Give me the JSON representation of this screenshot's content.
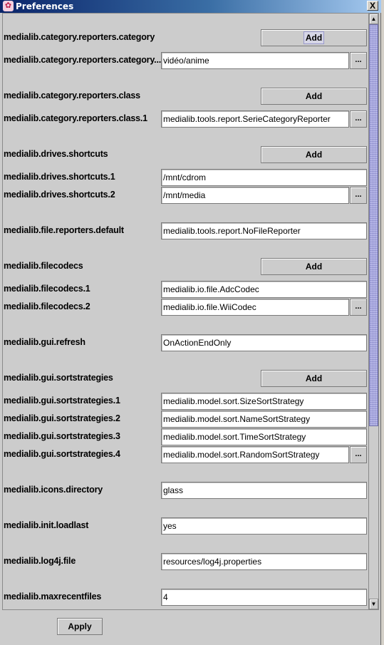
{
  "window": {
    "title": "Preferences",
    "icon": "app-icon",
    "close_label": "X"
  },
  "colors": {
    "title_gradient_start": "#0a246a",
    "title_gradient_end": "#a6caf0",
    "panel_bg": "#cccccc",
    "scroll_thumb": "#b8b8e8"
  },
  "scrollbar": {
    "up_label": "▲",
    "down_label": "▼",
    "visible_fraction": 0.7,
    "scroll_position": 0
  },
  "preferences": [
    {
      "type": "group",
      "label": "medialib.category.reporters.category",
      "button": "Add",
      "focused": true
    },
    {
      "type": "entry",
      "label": "medialib.category.reporters.category...",
      "value": "vidéo/anime",
      "browse": "..."
    },
    {
      "type": "group",
      "label": "medialib.category.reporters.class",
      "button": "Add"
    },
    {
      "type": "entry",
      "label": "medialib.category.reporters.class.1",
      "value": "medialib.tools.report.SerieCategoryReporter",
      "browse": "..."
    },
    {
      "type": "group",
      "label": "medialib.drives.shortcuts",
      "button": "Add"
    },
    {
      "type": "entry",
      "label": "medialib.drives.shortcuts.1",
      "value": "/mnt/cdrom"
    },
    {
      "type": "entry",
      "label": "medialib.drives.shortcuts.2",
      "value": "/mnt/media",
      "browse": "..."
    },
    {
      "type": "single",
      "label": "medialib.file.reporters.default",
      "value": "medialib.tools.report.NoFileReporter"
    },
    {
      "type": "group",
      "label": "medialib.filecodecs",
      "button": "Add"
    },
    {
      "type": "entry",
      "label": "medialib.filecodecs.1",
      "value": "medialib.io.file.AdcCodec"
    },
    {
      "type": "entry",
      "label": "medialib.filecodecs.2",
      "value": "medialib.io.file.WiiCodec",
      "browse": "..."
    },
    {
      "type": "single",
      "label": "medialib.gui.refresh",
      "value": "OnActionEndOnly"
    },
    {
      "type": "group",
      "label": "medialib.gui.sortstrategies",
      "button": "Add"
    },
    {
      "type": "entry",
      "label": "medialib.gui.sortstrategies.1",
      "value": "medialib.model.sort.SizeSortStrategy"
    },
    {
      "type": "entry",
      "label": "medialib.gui.sortstrategies.2",
      "value": "medialib.model.sort.NameSortStrategy"
    },
    {
      "type": "entry",
      "label": "medialib.gui.sortstrategies.3",
      "value": "medialib.model.sort.TimeSortStrategy"
    },
    {
      "type": "entry",
      "label": "medialib.gui.sortstrategies.4",
      "value": "medialib.model.sort.RandomSortStrategy",
      "browse": "..."
    },
    {
      "type": "single",
      "label": "medialib.icons.directory",
      "value": "glass"
    },
    {
      "type": "single",
      "label": "medialib.init.loadlast",
      "value": "yes"
    },
    {
      "type": "single",
      "label": "medialib.log4j.file",
      "value": "resources/log4j.properties"
    },
    {
      "type": "single",
      "label": "medialib.maxrecentfiles",
      "value": "4"
    }
  ],
  "footer": {
    "apply_label": "Apply"
  }
}
